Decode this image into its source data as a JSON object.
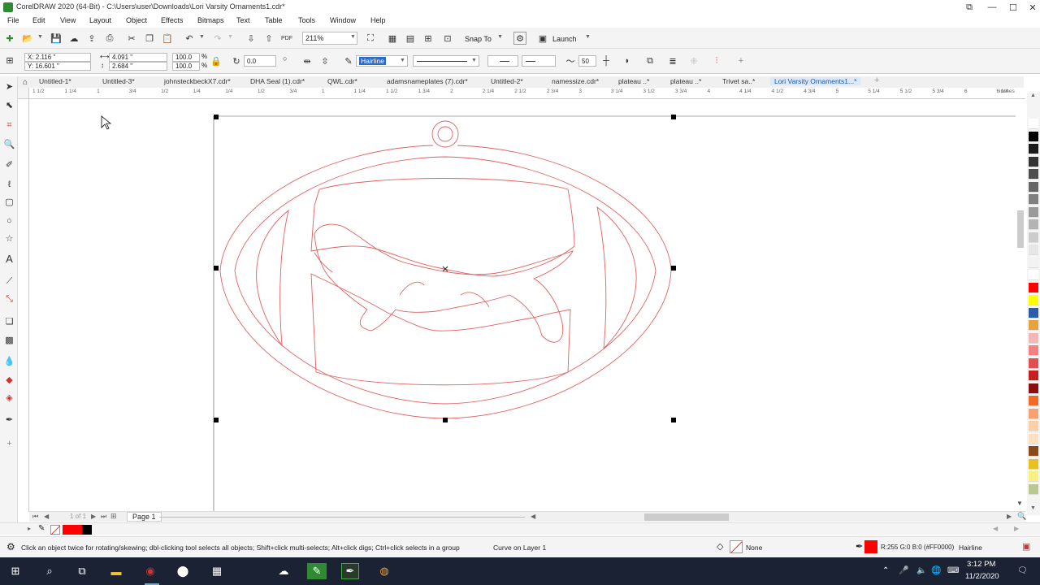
{
  "window": {
    "title": "CorelDRAW 2020 (64-Bit) - C:\\Users\\user\\Downloads\\Lori Varsity Ornaments1.cdr*"
  },
  "menus": [
    "File",
    "Edit",
    "View",
    "Layout",
    "Object",
    "Effects",
    "Bitmaps",
    "Text",
    "Table",
    "Tools",
    "Window",
    "Help"
  ],
  "toolbar": {
    "zoom": "211%",
    "snap_to": "Snap To",
    "launch": "Launch"
  },
  "property_bar": {
    "x": "X: 2.116 \"",
    "y": "Y: 16.601 \"",
    "width": "4.091 \"",
    "height": "2.684 \"",
    "scale_w": "100.0",
    "scale_h": "100.0",
    "pct1": "%",
    "pct2": "%",
    "angle": "0.0",
    "outline_width": "Hairline",
    "smoothing": "50"
  },
  "doc_tabs": [
    "Untitled-1*",
    "Untitled-3*",
    "johnsteckbeckX7.cdr*",
    "DHA Seal (1).cdr*",
    "QWL.cdr*",
    "adamsnameplates (7).cdr*",
    "Untitled-2*",
    "namessize.cdr*",
    "plateau ..*",
    "plateau ..*",
    "Trivet sa..*",
    "Lori Varsity Ornaments1...*"
  ],
  "ruler": {
    "h_labels": [
      "1 1/2",
      "1 1/4",
      "1",
      "3/4",
      "1/2",
      "1/4",
      "1/4",
      "1/2",
      "3/4",
      "1",
      "1 1/4",
      "1 1/2",
      "1 3/4",
      "2",
      "2 1/4",
      "2 1/2",
      "2 3/4",
      "3",
      "3 1/4",
      "3 1/2",
      "3 3/4",
      "4",
      "4 1/4",
      "4 1/2",
      "4 3/4",
      "5",
      "5 1/4",
      "5 1/2",
      "5 3/4",
      "6",
      "6 1/4"
    ],
    "unit": "inches"
  },
  "page_nav": {
    "of_label": "1 of 1",
    "page_tab": "Page 1"
  },
  "palette_colors": [
    "#ffffff",
    "#000000",
    "#1a1a1a",
    "#333333",
    "#4d4d4d",
    "#666666",
    "#808080",
    "#999999",
    "#b3b3b3",
    "#cccccc",
    "#e6e6e6",
    "#f2f2f2",
    "#ffffff",
    "#ff0000",
    "#ffff00",
    "#2a5caa",
    "#e8a33c",
    "#f4b6b6",
    "#f28080",
    "#e05050",
    "#c41e1e",
    "#8a1010",
    "#f06a2a",
    "#f8a070",
    "#fbd0a8",
    "#ffe0c0",
    "#8a4a1a",
    "#e8c020",
    "#f8f080",
    "#b8c890"
  ],
  "doc_palette": [
    "#ff0000",
    "#ff0000",
    "#000000"
  ],
  "status": {
    "hint": "Click an object twice for rotating/skewing; dbl-clicking tool selects all objects; Shift+click multi-selects; Alt+click digs; Ctrl+click selects in a group",
    "layer": "Curve on Layer 1",
    "fill": "None",
    "outline_color": "R:255 G:0 B:0 (#FF0000)",
    "outline_width": "Hairline"
  },
  "taskbar": {
    "time": "3:12 PM",
    "date": "11/2/2020"
  }
}
